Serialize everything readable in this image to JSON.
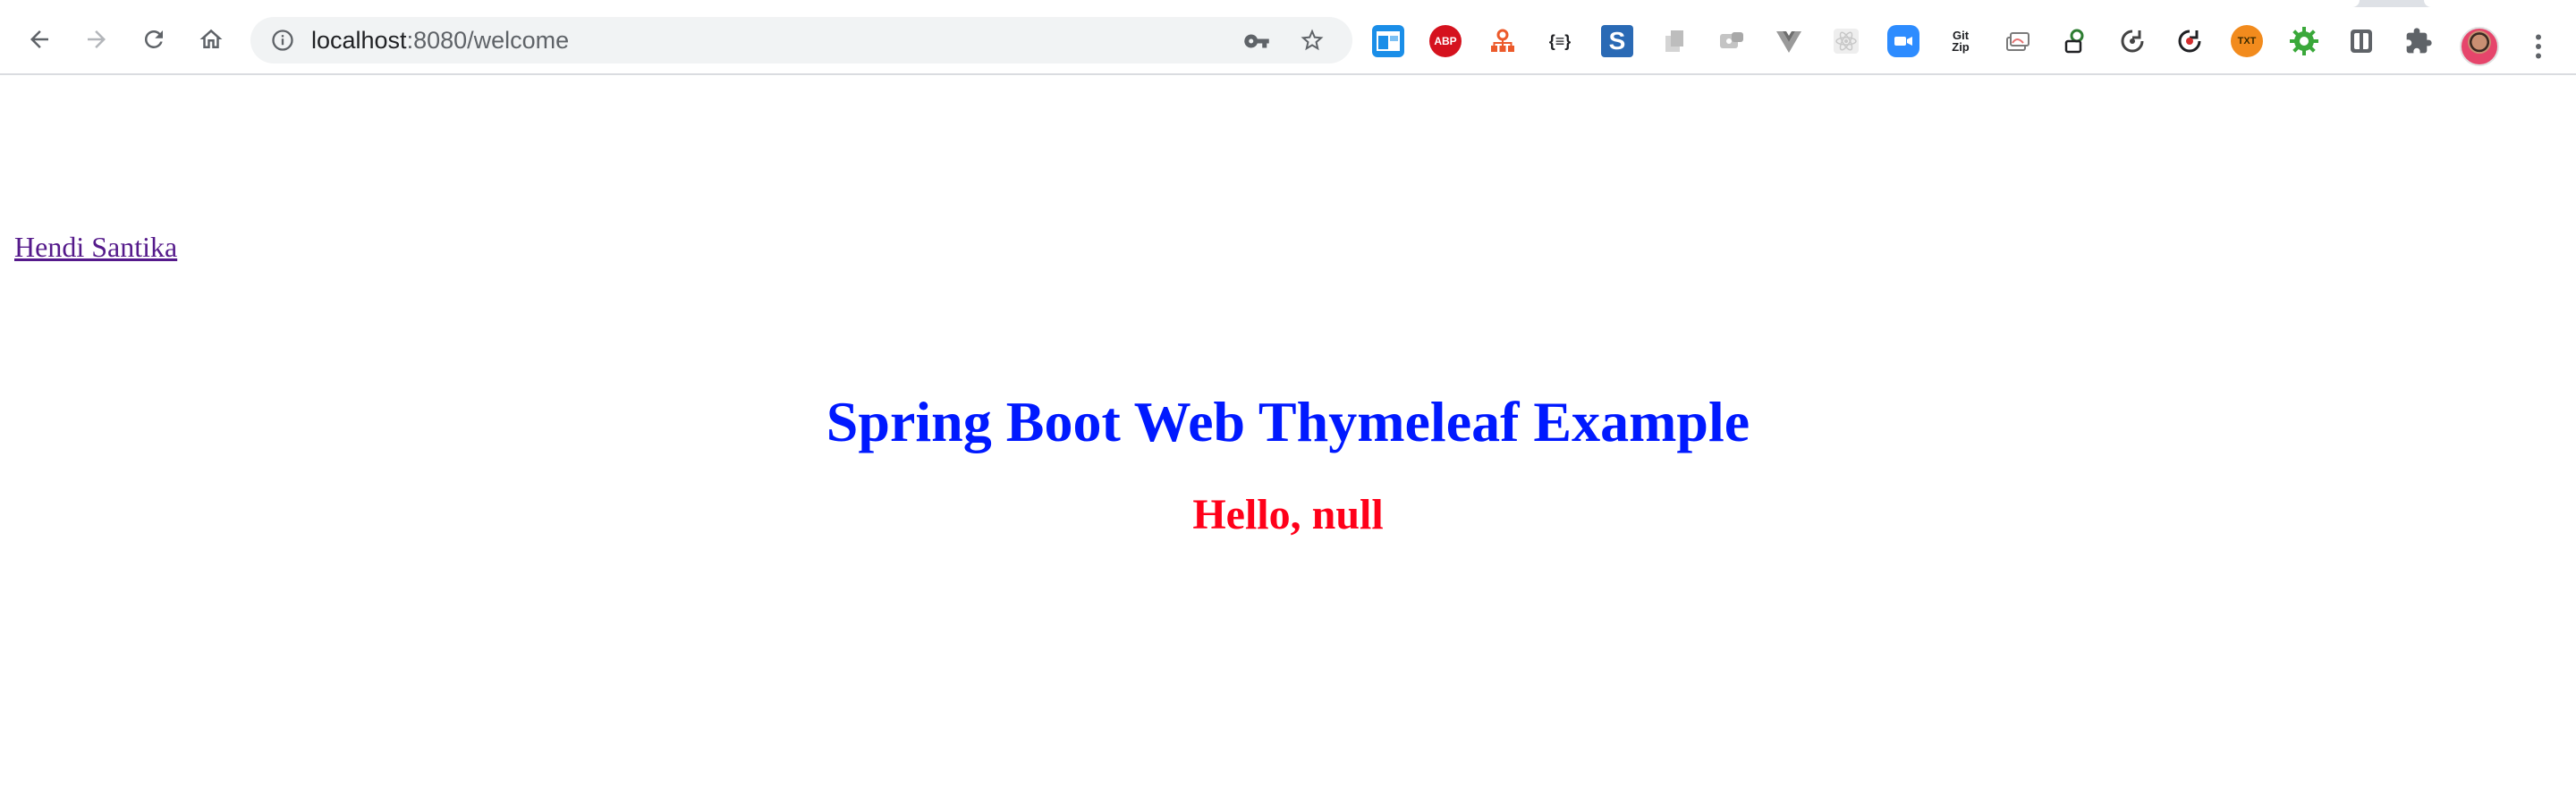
{
  "browser": {
    "url_host": "localhost",
    "url_rest": ":8080/welcome",
    "extensions": [
      {
        "name": "window-resizer-extension",
        "label": "",
        "color": "#1a8ee8"
      },
      {
        "name": "adblock-plus-extension",
        "label": "ABP",
        "color": "#d5121e"
      },
      {
        "name": "sitemap-extension",
        "label": "",
        "color": "#ec5a2b"
      },
      {
        "name": "json-formatter-extension",
        "label": "{≡}",
        "color": "#ffffff"
      },
      {
        "name": "s-extension",
        "label": "S",
        "color": "#2a6ab5"
      },
      {
        "name": "grey-docs-extension",
        "label": "",
        "color": "#d4d4d4"
      },
      {
        "name": "grey-chat-extension",
        "label": "",
        "color": "#c4c4c4"
      },
      {
        "name": "vue-devtools-extension",
        "label": "V",
        "color": "#9a9a9a"
      },
      {
        "name": "react-devtools-extension",
        "label": "",
        "color": "#d8d8d8"
      },
      {
        "name": "zoom-extension",
        "label": "",
        "color": "#2d8cff"
      },
      {
        "name": "gitzip-extension",
        "label": "Git Zip",
        "color": "#ffffff"
      },
      {
        "name": "layers-extension",
        "label": "",
        "color": "#8a8a8a"
      },
      {
        "name": "green-lock-extension",
        "label": "",
        "color": "#2e7d32"
      },
      {
        "name": "sync-extension",
        "label": "",
        "color": "#444444"
      },
      {
        "name": "refresh-red-extension",
        "label": "",
        "color": "#d32f2f"
      },
      {
        "name": "txt-extension",
        "label": "TXT",
        "color": "#f28b1d"
      },
      {
        "name": "green-gear-extension",
        "label": "",
        "color": "#3aa83a"
      },
      {
        "name": "shield-extension",
        "label": "",
        "color": "#5f6368"
      },
      {
        "name": "puzzle-extensions-menu",
        "label": "",
        "color": "#5f6368"
      }
    ]
  },
  "page": {
    "author_link": "Hendi Santika",
    "title": "Spring Boot Web Thymeleaf Example",
    "greeting": "Hello, null"
  },
  "colors": {
    "title": "#0019ff",
    "greeting": "#ff0019",
    "link_visited": "#551a8b"
  }
}
